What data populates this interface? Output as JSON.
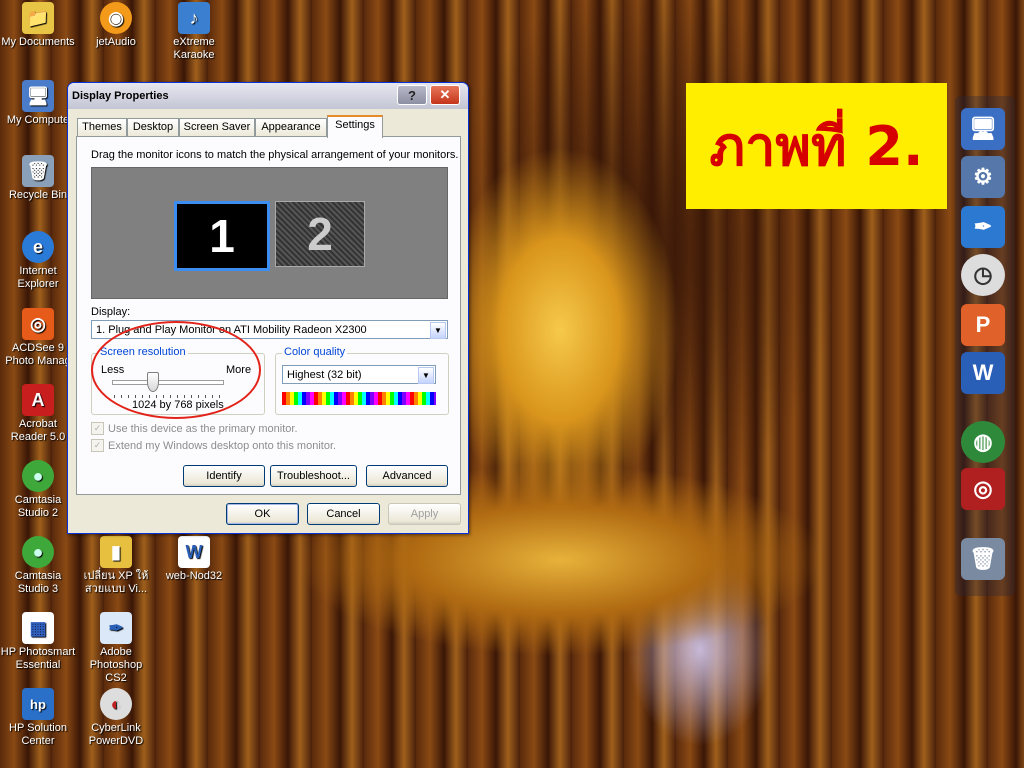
{
  "desktop_icons": [
    {
      "name": "desk-icon-my-documents",
      "label": "My Documents",
      "glyph": "📁"
    },
    {
      "name": "desk-icon-jetaudio",
      "label": "jetAudio",
      "glyph": "◉"
    },
    {
      "name": "desk-icon-extreme-karaoke",
      "label": "eXtreme Karaoke",
      "glyph": "♪"
    },
    {
      "name": "desk-icon-my-computer",
      "label": "My Compute",
      "glyph": "🖥"
    },
    {
      "name": "desk-icon-recycle-bin",
      "label": "Recycle Bin",
      "glyph": "🗑"
    },
    {
      "name": "desk-icon-internet-explorer",
      "label": "Internet Explorer",
      "glyph": "e"
    },
    {
      "name": "desk-icon-acdsee",
      "label": "ACDSee 9 Photo Manag",
      "glyph": "◎"
    },
    {
      "name": "desk-icon-acrobat",
      "label": "Acrobat Reader 5.0",
      "glyph": "A"
    },
    {
      "name": "desk-icon-camtasia-2",
      "label": "Camtasia Studio 2",
      "glyph": "●"
    },
    {
      "name": "desk-icon-camtasia-3",
      "label": "Camtasia Studio 3",
      "glyph": "●"
    },
    {
      "name": "desk-icon-xp-vista",
      "label": "เปลี่ยน XP ให้สวยแบบ Vi...",
      "glyph": "▮"
    },
    {
      "name": "desk-icon-web-nod32",
      "label": "web-Nod32",
      "glyph": "W"
    },
    {
      "name": "desk-icon-hp-photosmart",
      "label": "HP Photosmart Essential",
      "glyph": "▦"
    },
    {
      "name": "desk-icon-photoshop",
      "label": "Adobe Photoshop CS2",
      "glyph": "✒"
    },
    {
      "name": "desk-icon-hp-solution",
      "label": "HP Solution Center",
      "glyph": "hp"
    },
    {
      "name": "desk-icon-powerdvd",
      "label": "CyberLink PowerDVD",
      "glyph": "◐"
    }
  ],
  "banner": {
    "text": "ภาพที่ 2."
  },
  "dialog": {
    "title": "Display Properties",
    "help_glyph": "?",
    "close_glyph": "✕",
    "tabs": [
      "Themes",
      "Desktop",
      "Screen Saver",
      "Appearance",
      "Settings"
    ],
    "active_tab": "Settings",
    "instructions": "Drag the monitor icons to match the physical arrangement of your monitors.",
    "monitors": [
      "1",
      "2"
    ],
    "display_label": "Display:",
    "display_value": "1. Plug and Play Monitor on ATI Mobility Radeon X2300",
    "resolution": {
      "title": "Screen resolution",
      "less": "Less",
      "more": "More",
      "value": "1024 by 768 pixels"
    },
    "color_quality": {
      "title": "Color quality",
      "value": "Highest (32 bit)"
    },
    "checkboxes": {
      "primary": "Use this device as the primary monitor.",
      "extend": "Extend my Windows desktop onto this monitor."
    },
    "buttons": {
      "identify": "Identify",
      "troubleshoot": "Troubleshoot...",
      "advanced": "Advanced",
      "ok": "OK",
      "cancel": "Cancel",
      "apply": "Apply"
    }
  },
  "dock_items": [
    {
      "name": "dock-my-computer-icon",
      "glyph": "🖥",
      "color": "#3a6fc4"
    },
    {
      "name": "dock-network-icon",
      "glyph": "⚙",
      "color": "#5577aa"
    },
    {
      "name": "dock-feather-icon",
      "glyph": "✒",
      "color": "#2b79d0"
    },
    {
      "name": "dock-clock-icon",
      "glyph": "◷",
      "color": "#dddddd"
    },
    {
      "name": "dock-powerpoint-icon",
      "glyph": "P",
      "color": "#e0612a"
    },
    {
      "name": "dock-word-icon",
      "glyph": "W",
      "color": "#2a5fb8"
    },
    {
      "name": "dock-globe-icon",
      "glyph": "◍",
      "color": "#2e8a3a"
    },
    {
      "name": "dock-media-icon",
      "glyph": "◎",
      "color": "#b02020"
    },
    {
      "name": "dock-trash-icon",
      "glyph": "🗑",
      "color": "#7a8aa0"
    }
  ]
}
